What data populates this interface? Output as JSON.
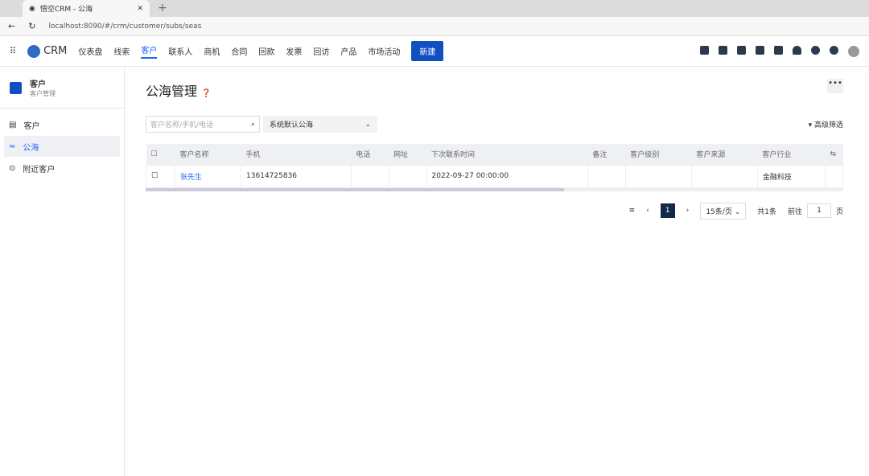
{
  "browser": {
    "tab_title": "悟空CRM - 公海",
    "url": "localhost:8090/#/crm/customer/subs/seas"
  },
  "nav": {
    "logo": "CRM",
    "items": [
      "仪表盘",
      "线索",
      "客户",
      "联系人",
      "商机",
      "合同",
      "回款",
      "发票",
      "回访",
      "产品",
      "市场活动"
    ],
    "active": 2,
    "new_label": "新建"
  },
  "sidebar": {
    "title": "客户",
    "subtitle": "客户管理",
    "items": [
      "客户",
      "公海",
      "附近客户"
    ],
    "active": 1
  },
  "main": {
    "title": "公海管理",
    "search_placeholder": "客户名称/手机/电话",
    "pool": "系统默认公海",
    "advanced": "高级筛选",
    "columns": [
      "客户名称",
      "手机",
      "电话",
      "网址",
      "下次联系时间",
      "备注",
      "客户级别",
      "客户来源",
      "客户行业"
    ],
    "rows": [
      [
        "张先生",
        "13614725836",
        "",
        "",
        "2022-09-27 00:00:00",
        "",
        "",
        "",
        "金融科技"
      ]
    ],
    "pager": {
      "page": "1",
      "size": "15条/页",
      "total": "共1条",
      "goto_label": "前往",
      "goto_value": "1",
      "page_unit": "页"
    }
  }
}
